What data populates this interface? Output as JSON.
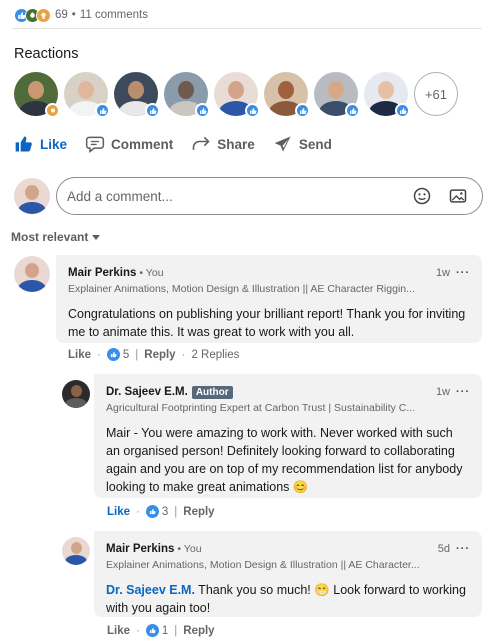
{
  "summary": {
    "count": "69",
    "comments": "11 comments"
  },
  "reactions": {
    "title": "Reactions",
    "more": "+61"
  },
  "actions": {
    "like": "Like",
    "comment": "Comment",
    "share": "Share",
    "send": "Send"
  },
  "composer": {
    "placeholder": "Add a comment..."
  },
  "sort": {
    "label": "Most relevant"
  },
  "comments": [
    {
      "name": "Mair Perkins",
      "degree": "• You",
      "headline": "Explainer Animations, Motion Design & Illustration || AE Character Riggin...",
      "time": "1w",
      "text": "Congratulations on publishing your brilliant report! Thank you for inviting me to animate this. It was great to work with you all.",
      "like": "Like",
      "likes": "5",
      "reply": "Reply",
      "replies": "2 Replies"
    },
    {
      "name": "Dr. Sajeev E.M.",
      "badge": "Author",
      "headline": "Agricultural Footprinting Expert at Carbon Trust | Sustainability C...",
      "time": "1w",
      "text": "Mair - You were amazing to work with. Never worked with such an organised person! Definitely looking forward to collaborating again and you are on top of my recommendation list for anybody looking to make great animations 😊",
      "like": "Like",
      "likes": "3",
      "reply": "Reply"
    },
    {
      "name": "Mair Perkins",
      "degree": "• You",
      "headline": "Explainer Animations, Motion Design & Illustration || AE Character...",
      "time": "5d",
      "mention": "Dr. Sajeev E.M.",
      "text": " Thank you so much! 😁 Look forward to working with you again too!",
      "like": "Like",
      "likes": "1",
      "reply": "Reply"
    }
  ],
  "colors": {
    "accent": "#0a66c2",
    "like_blue": "#378fe9",
    "celebrate_green": "#44712e",
    "insightful_yellow": "#e7a33e",
    "bubble_bg": "#f2f2f2"
  }
}
